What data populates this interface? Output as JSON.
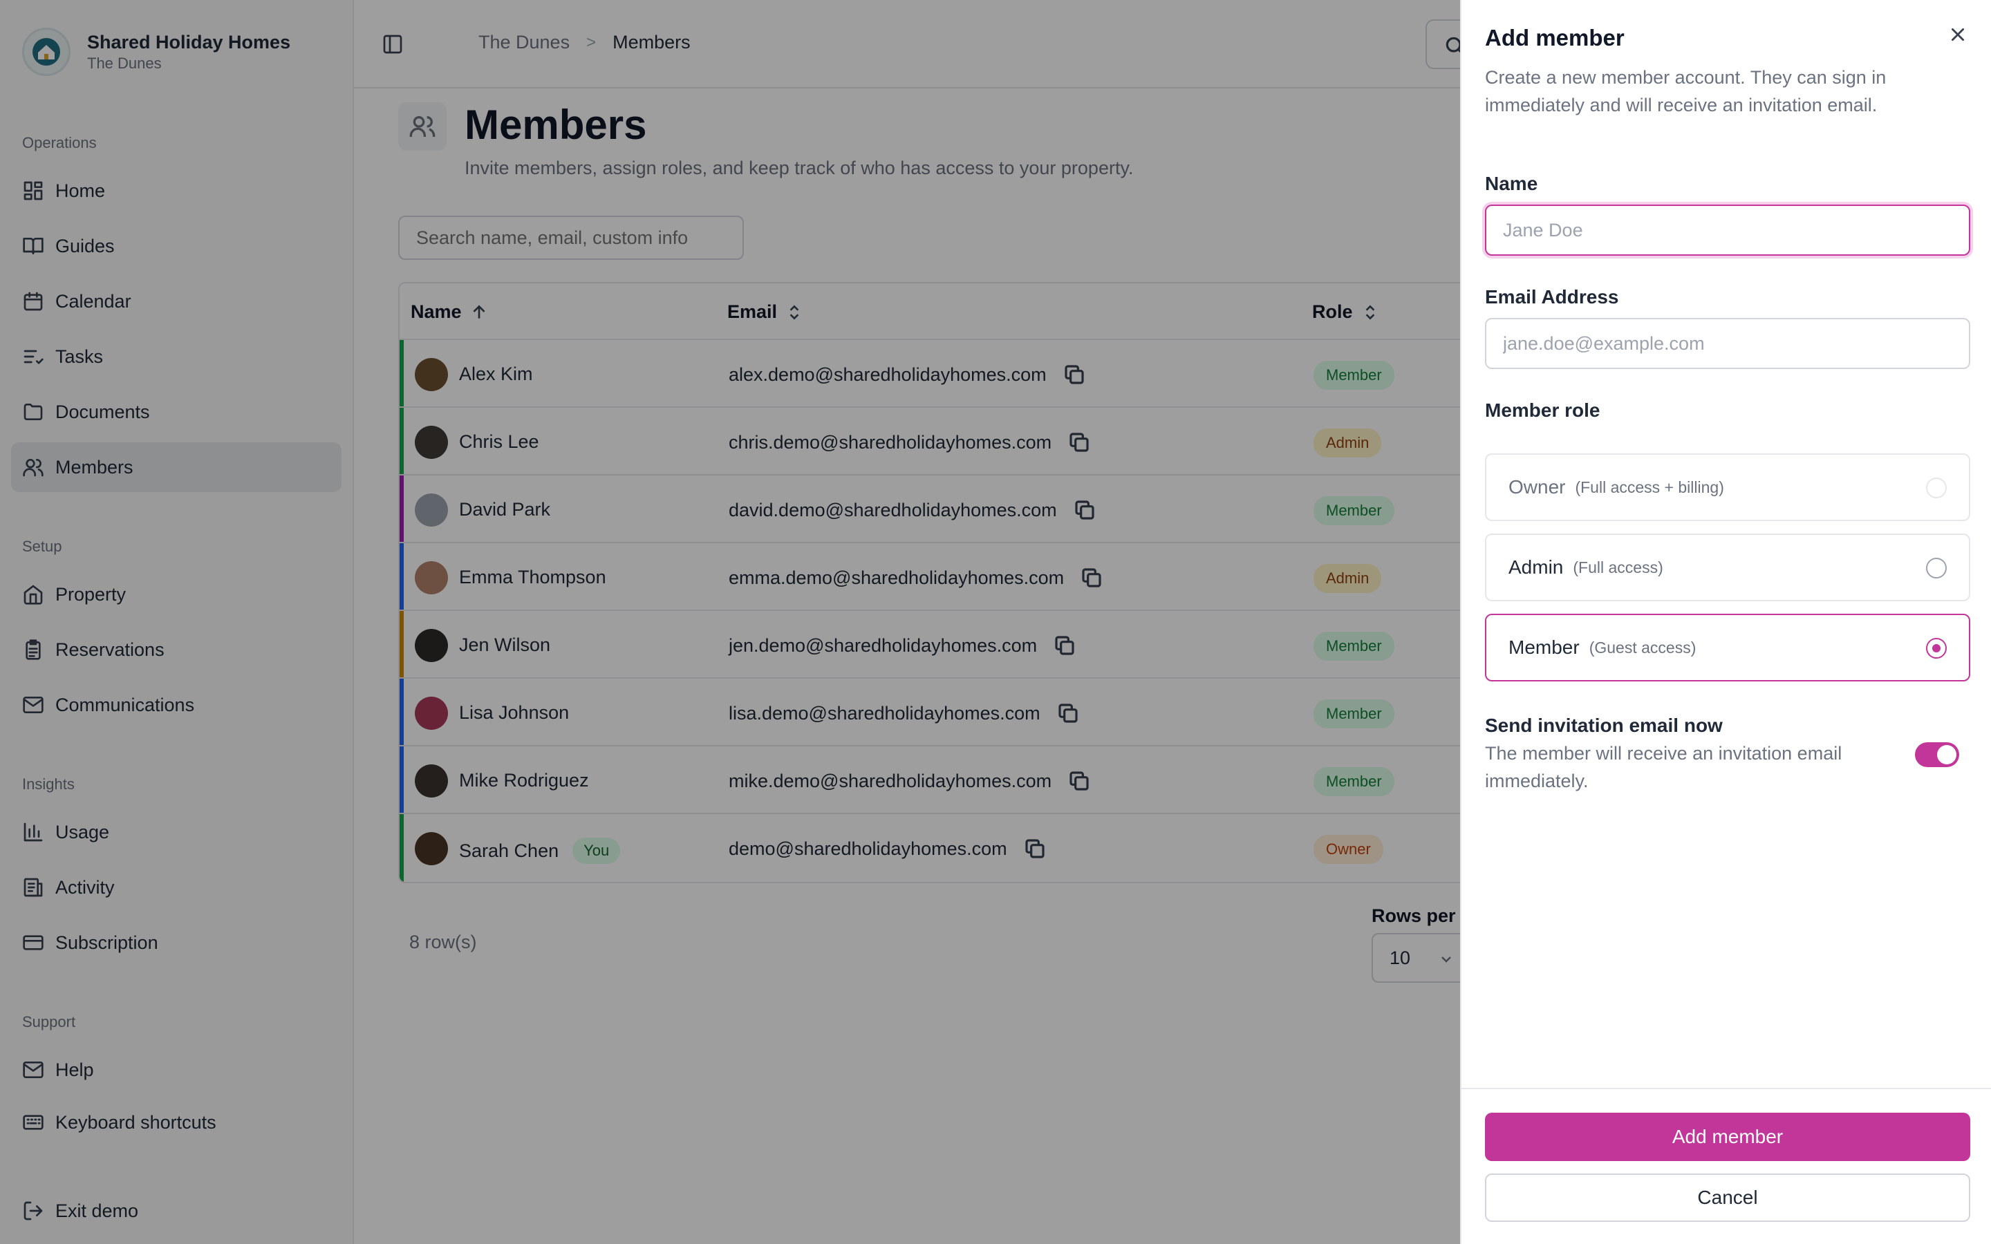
{
  "brand": {
    "title": "Shared Holiday Homes",
    "subtitle": "The Dunes"
  },
  "sidebar": {
    "sections": [
      {
        "title": "Operations",
        "items": [
          {
            "label": "Home",
            "icon": "home-icon"
          },
          {
            "label": "Guides",
            "icon": "book-icon"
          },
          {
            "label": "Calendar",
            "icon": "calendar-icon"
          },
          {
            "label": "Tasks",
            "icon": "tasks-icon"
          },
          {
            "label": "Documents",
            "icon": "folder-icon"
          },
          {
            "label": "Members",
            "icon": "users-icon",
            "active": true
          }
        ]
      },
      {
        "title": "Setup",
        "items": [
          {
            "label": "Property",
            "icon": "house-icon"
          },
          {
            "label": "Reservations",
            "icon": "clipboard-icon"
          },
          {
            "label": "Communications",
            "icon": "mail-icon"
          }
        ]
      },
      {
        "title": "Insights",
        "items": [
          {
            "label": "Usage",
            "icon": "bar-chart-icon"
          },
          {
            "label": "Activity",
            "icon": "activity-icon"
          },
          {
            "label": "Subscription",
            "icon": "credit-card-icon"
          }
        ]
      },
      {
        "title": "Support",
        "items": [
          {
            "label": "Help",
            "icon": "help-mail-icon"
          },
          {
            "label": "Keyboard shortcuts",
            "icon": "keyboard-icon"
          }
        ]
      }
    ],
    "exit": {
      "label": "Exit demo",
      "icon": "exit-icon"
    }
  },
  "breadcrumb": {
    "parent": "The Dunes",
    "separator": ">",
    "current": "Members"
  },
  "page": {
    "title": "Members",
    "subtitle": "Invite members, assign roles, and keep track of who has access to your property.",
    "search_placeholder": "Search name, email, custom info"
  },
  "table": {
    "columns": {
      "name": "Name",
      "email": "Email",
      "role": "Role"
    },
    "rows": [
      {
        "name": "Alex Kim",
        "email": "alex.demo@sharedholidayhomes.com",
        "role": "Member",
        "accent": "#16a34a",
        "avatar": "#6b4f2e"
      },
      {
        "name": "Chris Lee",
        "email": "chris.demo@sharedholidayhomes.com",
        "role": "Admin",
        "accent": "#16a34a",
        "avatar": "#3f3a36"
      },
      {
        "name": "David Park",
        "email": "david.demo@sharedholidayhomes.com",
        "role": "Member",
        "accent": "#a21caf",
        "avatar": "#9ca3af"
      },
      {
        "name": "Emma Thompson",
        "email": "emma.demo@sharedholidayhomes.com",
        "role": "Admin",
        "accent": "#2563eb",
        "avatar": "#b0816a"
      },
      {
        "name": "Jen Wilson",
        "email": "jen.demo@sharedholidayhomes.com",
        "role": "Member",
        "accent": "#ca8a04",
        "avatar": "#2e2a28"
      },
      {
        "name": "Lisa Johnson",
        "email": "lisa.demo@sharedholidayhomes.com",
        "role": "Member",
        "accent": "#2563eb",
        "avatar": "#a8395a"
      },
      {
        "name": "Mike Rodriguez",
        "email": "mike.demo@sharedholidayhomes.com",
        "role": "Member",
        "accent": "#2563eb",
        "avatar": "#3b3330"
      },
      {
        "name": "Sarah Chen",
        "email": "demo@sharedholidayhomes.com",
        "role": "Owner",
        "accent": "#16a34a",
        "avatar": "#4a3526",
        "you": "You"
      }
    ],
    "row_count": "8 row(s)",
    "rows_per_page_label": "Rows per p",
    "rows_per_page_value": "10"
  },
  "drawer": {
    "title": "Add member",
    "description": "Create a new member account. They can sign in immediately and will receive an invitation email.",
    "name_label": "Name",
    "name_placeholder": "Jane Doe",
    "email_label": "Email Address",
    "email_placeholder": "jane.doe@example.com",
    "role_label": "Member role",
    "roles": [
      {
        "name": "Owner",
        "desc": "(Full access + billing)",
        "state": "disabled"
      },
      {
        "name": "Admin",
        "desc": "(Full access)",
        "state": "unselected"
      },
      {
        "name": "Member",
        "desc": "(Guest access)",
        "state": "selected"
      }
    ],
    "invite_title": "Send invitation email now",
    "invite_desc": "The member will receive an invitation email immediately.",
    "invite_enabled": true,
    "submit_label": "Add member",
    "cancel_label": "Cancel"
  },
  "colors": {
    "accent": "#c2369a",
    "overlay": "rgba(0,0,0,0.38)"
  }
}
